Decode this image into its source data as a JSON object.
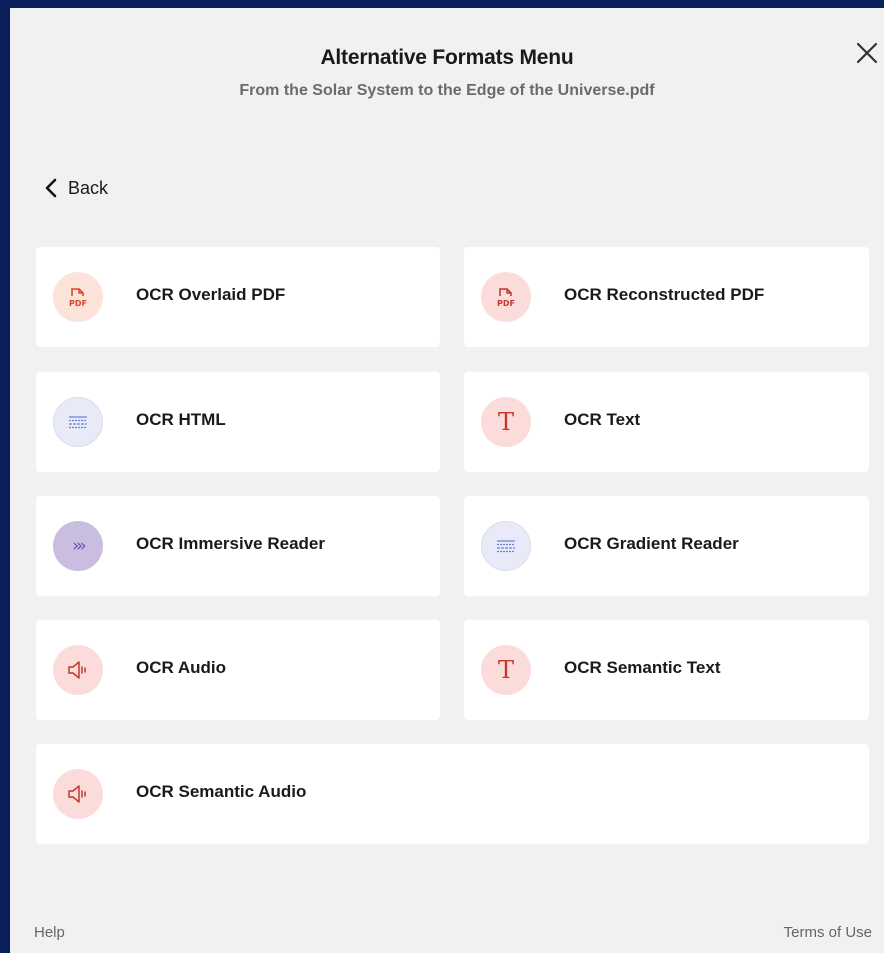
{
  "dialog": {
    "title": "Alternative Formats Menu",
    "subtitle": "From the Solar System to the Edge of the Universe.pdf",
    "back_label": "Back"
  },
  "formats": [
    {
      "label": "OCR Overlaid PDF",
      "icon": "pdf-icon"
    },
    {
      "label": "OCR Reconstructed PDF",
      "icon": "pdf-icon"
    },
    {
      "label": "OCR HTML",
      "icon": "html-lines-icon"
    },
    {
      "label": "OCR Text",
      "icon": "text-t-icon"
    },
    {
      "label": "OCR Immersive Reader",
      "icon": "chevrons-icon"
    },
    {
      "label": "OCR Gradient Reader",
      "icon": "gradient-lines-icon"
    },
    {
      "label": "OCR Audio",
      "icon": "speaker-icon"
    },
    {
      "label": "OCR Semantic Text",
      "icon": "text-t-icon"
    },
    {
      "label": "OCR Semantic Audio",
      "icon": "speaker-icon"
    }
  ],
  "footer": {
    "help": "Help",
    "terms": "Terms of Use"
  },
  "icon_labels": {
    "pdf": "PDF",
    "text": "T",
    "chevrons": "›››"
  },
  "colors": {
    "frame": "#0b1f5c",
    "background": "#f1f1f2",
    "card": "#ffffff",
    "pdf_red": "#d9452b",
    "text_red": "#c0392b",
    "html_blue": "#6b7fd7",
    "immersive_purple": "#7b5fb8"
  }
}
